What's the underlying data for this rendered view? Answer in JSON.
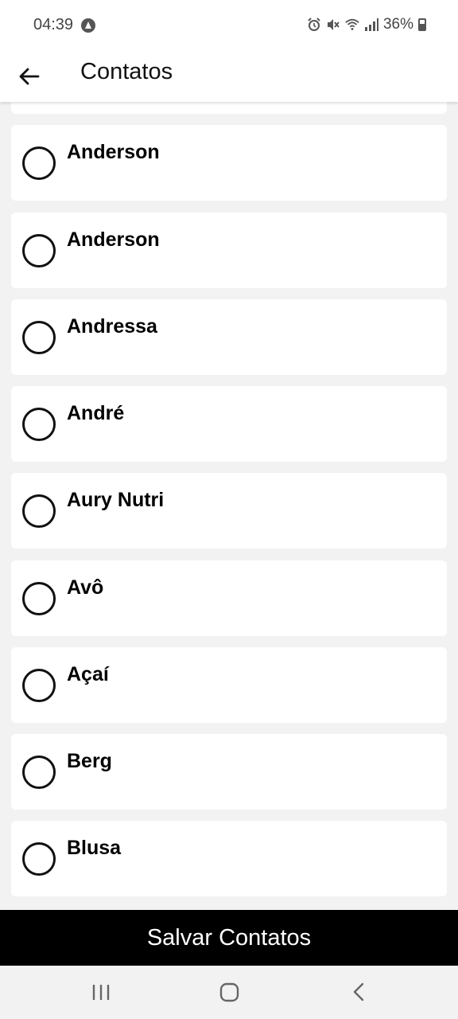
{
  "status_bar": {
    "time": "04:39",
    "battery": "36%",
    "icons": [
      "app-notification-icon",
      "alarm-icon",
      "mute-icon",
      "wifi-icon",
      "signal-icon",
      "battery-icon"
    ]
  },
  "app_bar": {
    "title": "Contatos",
    "back_icon": "arrow-left-icon"
  },
  "contacts": [
    {
      "name": "Anderson",
      "selected": false
    },
    {
      "name": "Anderson",
      "selected": false
    },
    {
      "name": "Andressa",
      "selected": false
    },
    {
      "name": "André",
      "selected": false
    },
    {
      "name": "Aury Nutri",
      "selected": false
    },
    {
      "name": "Avô",
      "selected": false
    },
    {
      "name": "Açaí",
      "selected": false
    },
    {
      "name": "Berg",
      "selected": false
    },
    {
      "name": "Blusa",
      "selected": false
    }
  ],
  "save_button": {
    "label": "Salvar Contatos"
  },
  "nav_bar": {
    "icons": [
      "recents-icon",
      "home-icon",
      "back-icon"
    ]
  },
  "colors": {
    "background": "#f2f2f2",
    "card": "#ffffff",
    "save_bar": "#000000",
    "save_text": "#ffffff"
  }
}
